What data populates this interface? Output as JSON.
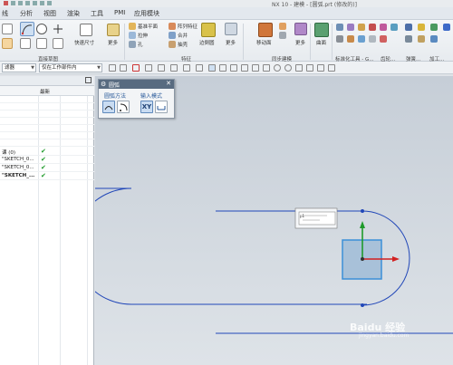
{
  "window": {
    "title": "NX 10 - 建模 - [圆弧.prt (修改的)]"
  },
  "menubar": {
    "items": [
      "线",
      "分析",
      "视图",
      "渲染",
      "工具",
      "PMI",
      "应用模块"
    ]
  },
  "ribbon": {
    "sketch_tools": {
      "quick_dimension": "快速尺寸",
      "more": "更多",
      "group_label": "直接草图"
    },
    "feature": {
      "datum_plane": "基准平面",
      "extrude": "拉伸",
      "hole": "孔",
      "pattern_feature": "阵列特征",
      "unite": "合并",
      "shell": "抽壳",
      "edge_blend": "边倒圆",
      "more": "更多",
      "group_label": "特征"
    },
    "sync_modeling": {
      "move_face": "移动面",
      "more": "更多",
      "group_label": "同步建模"
    },
    "surface": {
      "surface": "曲面",
      "group_label": "曲面"
    },
    "groups_right": [
      "标准化工具 - G...",
      "齿轮...",
      "弹簧...",
      "加工..."
    ]
  },
  "filterbar": {
    "type_filter": "滤器",
    "scope_filter": "仅在工作部件内"
  },
  "part_navigator": {
    "columns": [
      "",
      "最新"
    ],
    "rows": [
      {
        "label": "课 (0)",
        "check": true
      },
      {
        "label": "\"SKETCH_0...",
        "check": true
      },
      {
        "label": "\"SKETCH_0...",
        "check": true
      },
      {
        "label": "\"SKETCH_...",
        "check": true
      }
    ]
  },
  "arc_dialog": {
    "title": "圆弧",
    "arc_method_label": "圆弧方法",
    "input_mode_label": "输入模式",
    "xy_button": "XY"
  },
  "canvas": {
    "annotation_value": "p1"
  },
  "watermark": {
    "brand": "Baidu 经验",
    "sub": "jingyan.baidu.com"
  },
  "colors": {
    "sketch_curve": "#2147b8",
    "selected_box": "#3b8fd8",
    "axis_x": "#d22020",
    "axis_y": "#1e9a2a",
    "dialog_header": "#586b80"
  }
}
